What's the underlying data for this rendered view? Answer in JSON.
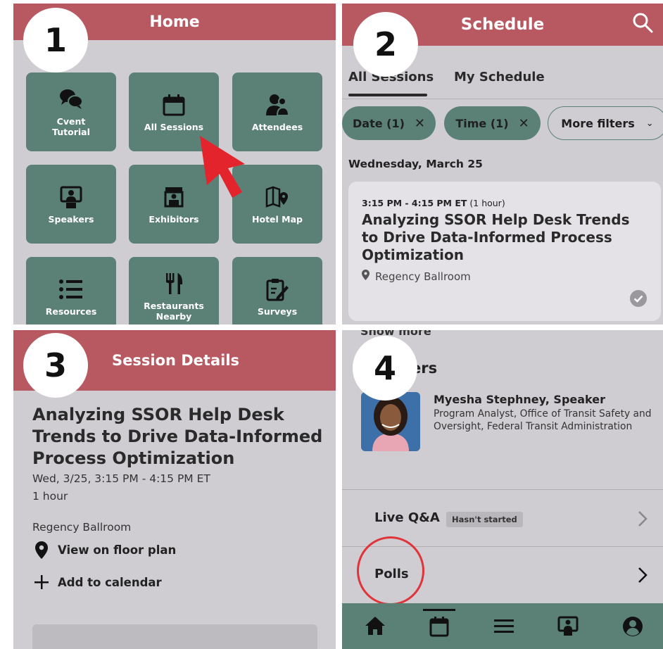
{
  "colors": {
    "header_red": "#b85860",
    "teal": "#5b8177",
    "panel_bg": "#cfcdd1",
    "annotation_red": "#e0333a"
  },
  "badges": [
    "1",
    "2",
    "3",
    "4"
  ],
  "panel1": {
    "title": "Home",
    "tiles": [
      {
        "label": "Cvent\nTutorial",
        "icon": "chat-bubbles-icon"
      },
      {
        "label": "All Sessions",
        "icon": "calendar-icon"
      },
      {
        "label": "Attendees",
        "icon": "attendees-icon"
      },
      {
        "label": "Speakers",
        "icon": "presenter-icon"
      },
      {
        "label": "Exhibitors",
        "icon": "booth-icon"
      },
      {
        "label": "Hotel Map",
        "icon": "map-pin-icon"
      },
      {
        "label": "Resources",
        "icon": "list-icon"
      },
      {
        "label": "Restaurants\nNearby",
        "icon": "utensils-icon"
      },
      {
        "label": "Surveys",
        "icon": "clipboard-icon"
      }
    ]
  },
  "panel2": {
    "title": "Schedule",
    "tabs": {
      "all": "All Sessions",
      "mine": "My Schedule"
    },
    "chips": {
      "date": "Date (1)",
      "time": "Time (1)",
      "more": "More filters",
      "clear_glyph": "✕",
      "dropdown_glyph": "⌄"
    },
    "date_heading": "Wednesday, March 25",
    "session": {
      "time": "3:15 PM - 4:15 PM ET",
      "duration": "(1 hour)",
      "title": "Analyzing SSOR Help Desk Trends to Drive Data-Informed Process Optimization",
      "location": "Regency Ballroom"
    }
  },
  "panel3": {
    "title": "Session Details",
    "session_title": "Analyzing SSOR Help Desk Trends to Drive Data-Informed Process Optimization",
    "datetime": "Wed, 3/25, 3:15 PM - 4:15 PM ET",
    "duration": "1 hour",
    "location": "Regency Ballroom",
    "floor_plan": "View on floor plan",
    "add_calendar": "Add to calendar"
  },
  "panel4": {
    "show_more": "Show more",
    "speakers_heading": "Speakers",
    "speaker_name": "Myesha Stephney, Speaker",
    "speaker_desc": "Program Analyst, Office of Transit Safety and Oversight, Federal Transit Administration",
    "qa_label": "Live Q&A",
    "qa_status": "Hasn't started",
    "polls_label": "Polls"
  }
}
